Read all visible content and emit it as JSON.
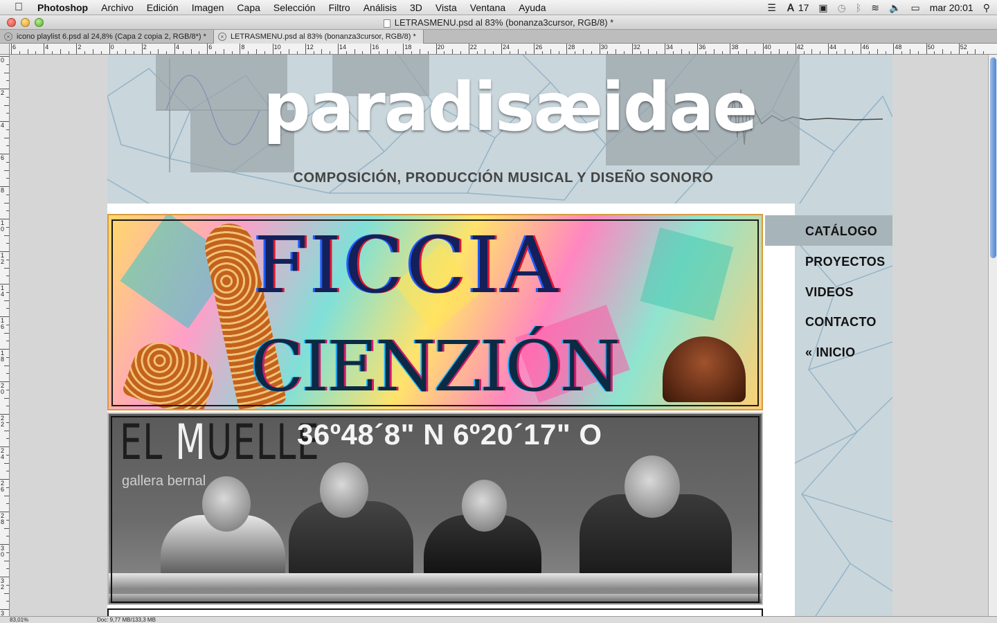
{
  "menubar": {
    "app_name": "Photoshop",
    "items": [
      "Archivo",
      "Edición",
      "Imagen",
      "Capa",
      "Selección",
      "Filtro",
      "Análisis",
      "3D",
      "Vista",
      "Ventana",
      "Ayuda"
    ],
    "adobe_count": "17",
    "clock": "mar 20:01"
  },
  "window": {
    "title": "LETRASMENU.psd al 83% (bonanza3cursor, RGB/8) *"
  },
  "tabs": [
    {
      "label": "icono playlist 6.psd al 24,8% (Capa 2 copia 2, RGB/8*) *"
    },
    {
      "label": "LETRASMENU.psd al 83% (bonanza3cursor, RGB/8) *"
    }
  ],
  "ruler": {
    "h_labels": [
      "6",
      "4",
      "2",
      "0",
      "2",
      "4",
      "6",
      "8",
      "10",
      "12",
      "14",
      "16",
      "18",
      "20",
      "22",
      "24",
      "26",
      "28",
      "30",
      "32",
      "34",
      "36",
      "38",
      "40",
      "42",
      "44",
      "46",
      "48",
      "50",
      "52"
    ],
    "v_labels": [
      "0",
      "2",
      "4",
      "6",
      "8",
      "10",
      "12",
      "14",
      "16",
      "18",
      "20",
      "22",
      "24",
      "26",
      "28",
      "30",
      "32",
      "3"
    ]
  },
  "document": {
    "logo_text": "paradisæidae",
    "tagline": "COMPOSICIÓN, PRODUCCIÓN MUSICAL Y DISEÑO SONORO",
    "nav": [
      "CATÁLOGO",
      "PROYECTOS",
      "VIDEOS",
      "CONTACTO",
      "« INICIO"
    ],
    "banner1_title": "FICCIA",
    "banner1_sub": "CIENZIÓN",
    "banner2_logo_pre": "EL ",
    "banner2_logo_m": "M",
    "banner2_logo_post": "UELLE",
    "banner2_sub": "gallera bernal",
    "banner2_coords": "36º48´8\" N 6º20´17\" O"
  },
  "statusbar": {
    "zoom": "83,01%",
    "doc": "Doc: 9,77 MB/133,3 MB"
  },
  "colors": {
    "header_band": "#c9d6dc",
    "nav_active": "#a7b4ba",
    "scroll_thumb": "#4f86d0"
  }
}
